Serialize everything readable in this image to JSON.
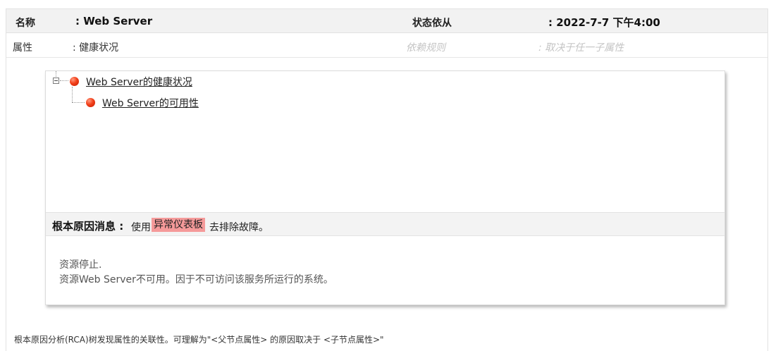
{
  "header": {
    "name_label": "名称",
    "name_value": ": Web Server",
    "status_label": "状态依从",
    "status_value": ": 2022-7-7 下午4:00"
  },
  "attribute_row": {
    "attr_label": "属性",
    "attr_value": ": 健康状况",
    "rule_label": "依赖规则",
    "rule_value": ": 取决于任一子属性"
  },
  "tree": {
    "root": {
      "label": "Web Server的健康状况",
      "status": "critical",
      "expanded": true
    },
    "children": [
      {
        "label": "Web Server的可用性",
        "status": "critical"
      }
    ]
  },
  "rca": {
    "title": "根本原因消息 :",
    "prefix": "使用",
    "link": "异常仪表板",
    "suffix": "去排除故障。",
    "messages": [
      "资源停止.",
      "资源Web Server不可用。因于不可访问该服务所运行的系统。"
    ]
  },
  "footer_note": "根本原因分析(RCA)树发现属性的关联性。可理解为\"<父节点属性> 的原因取决于 <子节点属性>\"",
  "colors": {
    "critical": "#f2401a",
    "link_highlight": "#f59a9a",
    "header_bg": "#f2f2f2"
  }
}
